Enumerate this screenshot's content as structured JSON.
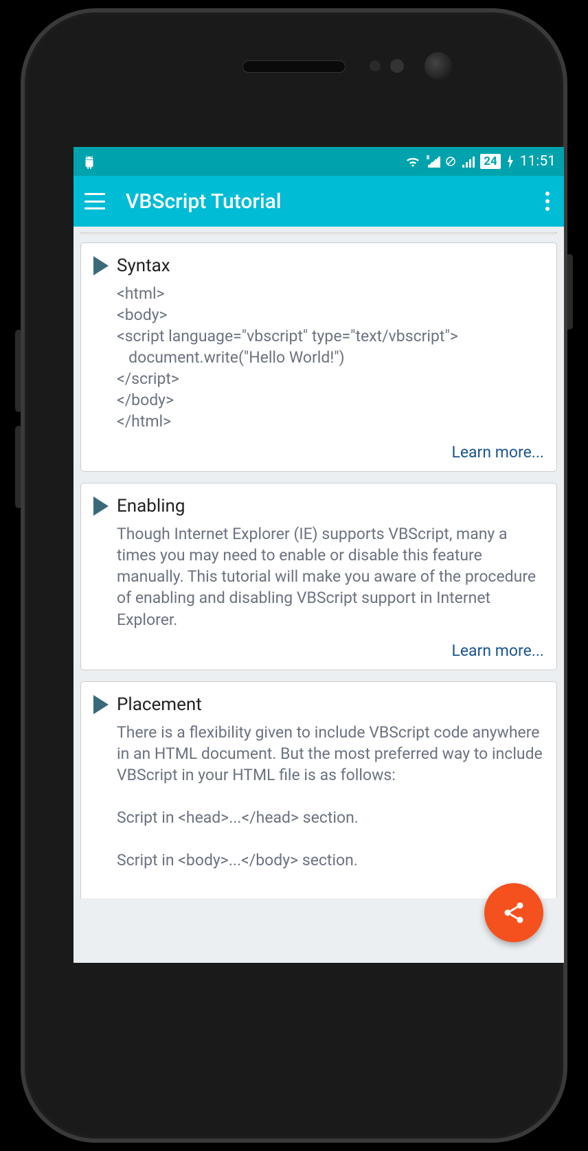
{
  "statusBar": {
    "battery": "24",
    "time": "11:51"
  },
  "appBar": {
    "title": "VBScript Tutorial"
  },
  "cards": [
    {
      "title": "Syntax",
      "body_lines": [
        "<html>",
        "<body>",
        "<script language=\"vbscript\" type=\"text/vbscript\">",
        "   document.write(\"Hello World!\")",
        "</script>",
        "</body>",
        "</html>"
      ],
      "learn_more": "Learn more..."
    },
    {
      "title": "Enabling",
      "body_text": "Though Internet Explorer (IE) supports VBScript, many a times you may need to enable or disable this feature manually. This tutorial will make you aware of the procedure of enabling and disabling VBScript support in Internet Explorer.",
      "learn_more": "Learn more..."
    },
    {
      "title": "Placement",
      "body_text": "There is a flexibility given to include VBScript code anywhere in an HTML document. But the most preferred way to include VBScript in your HTML file is as follows:",
      "extra_lines": [
        "Script in <head>...</head> section.",
        "Script in <body>...</body> section."
      ]
    }
  ]
}
